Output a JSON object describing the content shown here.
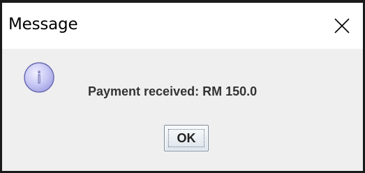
{
  "window": {
    "title": "Message"
  },
  "icons": {
    "close": "close-icon",
    "message_type": "information-icon",
    "message_type_glyph": "i"
  },
  "dialog": {
    "message": "Payment received: RM 150.0",
    "ok_label": "OK"
  },
  "colors": {
    "titlebar_bg": "#ffffff",
    "dialog_bg": "#efefef",
    "icon_fill": "#c9c9f5",
    "icon_border": "#6b6bb3"
  }
}
